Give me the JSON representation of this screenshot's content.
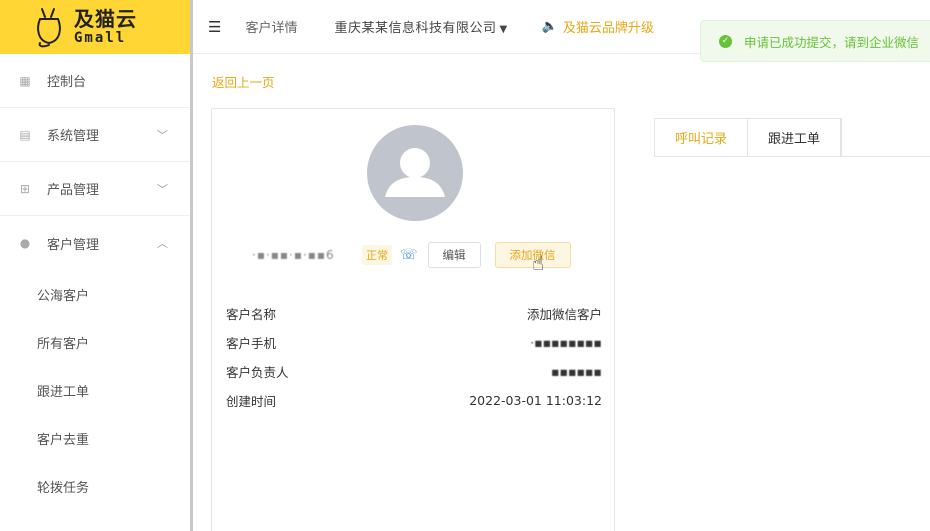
{
  "logo": {
    "cn": "及猫云",
    "en": "Gmall"
  },
  "sidebar": {
    "items": [
      {
        "label": "控制台"
      },
      {
        "label": "系统管理"
      },
      {
        "label": "产品管理"
      },
      {
        "label": "客户管理"
      }
    ],
    "sub_items": [
      {
        "label": "公海客户"
      },
      {
        "label": "所有客户"
      },
      {
        "label": "跟进工单"
      },
      {
        "label": "客户去重"
      },
      {
        "label": "轮拨任务"
      }
    ]
  },
  "header": {
    "crumb": "客户详情",
    "company": "重庆某某信息科技有限公司",
    "notice": "及猫云品牌升级"
  },
  "toast": {
    "message": "申请已成功提交，请到企业微信"
  },
  "main": {
    "back_link": "返回上一页",
    "customer": {
      "name_masked": "·▪·▪▪·▪·▪▪6",
      "status": "正常",
      "edit_label": "编辑",
      "add_wechat_label": "添加微信"
    },
    "info": [
      {
        "label": "客户名称",
        "value": "添加微信客户"
      },
      {
        "label": "客户手机",
        "value": "·▪▪▪▪▪▪▪▪"
      },
      {
        "label": "客户负责人",
        "value": "▪▪▪▪▪▪"
      },
      {
        "label": "创建时间",
        "value": "2022-03-01 11:03:12"
      }
    ],
    "tabs": [
      {
        "label": "呼叫记录"
      },
      {
        "label": "跟进工单"
      }
    ]
  },
  "colors": {
    "brand": "#ffd633",
    "accent": "#e6a817",
    "success": "#67c23a",
    "link": "#3a8ee6"
  }
}
